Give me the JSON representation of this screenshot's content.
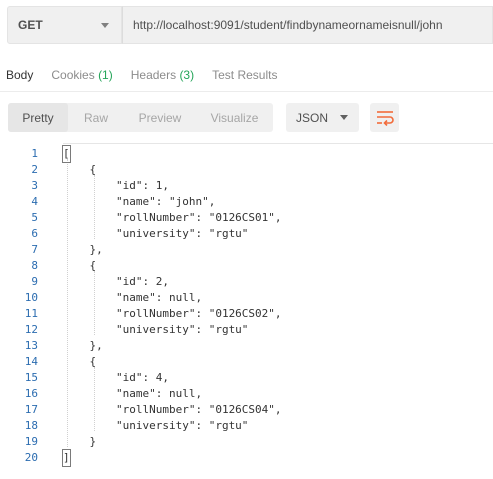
{
  "request": {
    "method": "GET",
    "url": "http://localhost:9091/student/findbynameornameisnull/john"
  },
  "response_tabs": {
    "body": "Body",
    "cookies": "Cookies",
    "cookies_count": "(1)",
    "headers": "Headers",
    "headers_count": "(3)",
    "test_results": "Test Results"
  },
  "format_toolbar": {
    "pretty": "Pretty",
    "raw": "Raw",
    "preview": "Preview",
    "visualize": "Visualize",
    "language": "JSON",
    "wrap_icon": "wrap-lines-icon"
  },
  "colors": {
    "accent": "#f26b3a",
    "count_green": "#26a55a",
    "line_number_blue": "#2b6cb0"
  },
  "code": {
    "line_numbers": [
      "1",
      "2",
      "3",
      "4",
      "5",
      "6",
      "7",
      "8",
      "9",
      "10",
      "11",
      "12",
      "13",
      "14",
      "15",
      "16",
      "17",
      "18",
      "19",
      "20"
    ],
    "lines": [
      "[",
      "    {",
      "        \"id\": 1,",
      "        \"name\": \"john\",",
      "        \"rollNumber\": \"0126CS01\",",
      "        \"university\": \"rgtu\"",
      "    },",
      "    {",
      "        \"id\": 2,",
      "        \"name\": null,",
      "        \"rollNumber\": \"0126CS02\",",
      "        \"university\": \"rgtu\"",
      "    },",
      "    {",
      "        \"id\": 4,",
      "        \"name\": null,",
      "        \"rollNumber\": \"0126CS04\",",
      "        \"university\": \"rgtu\"",
      "    }",
      "]"
    ]
  }
}
